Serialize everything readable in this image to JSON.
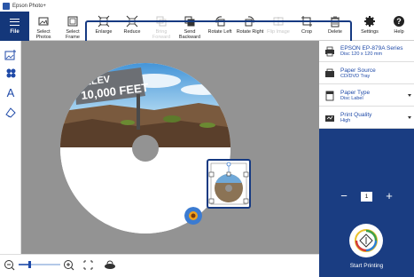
{
  "window": {
    "title": "Epson Photo+"
  },
  "toolbar": {
    "file": "File",
    "items": [
      {
        "label": "Select Photos",
        "icon": "photo-icon",
        "enabled": true
      },
      {
        "label": "Select Frame",
        "icon": "frame-icon",
        "enabled": true
      },
      {
        "label": "Enlarge",
        "icon": "enlarge-icon",
        "enabled": true
      },
      {
        "label": "Reduce",
        "icon": "reduce-icon",
        "enabled": true
      },
      {
        "label": "Bring Forward",
        "icon": "bring-forward-icon",
        "enabled": false
      },
      {
        "label": "Send Backward",
        "icon": "send-backward-icon",
        "enabled": true
      },
      {
        "label": "Rotate Left",
        "icon": "rotate-left-icon",
        "enabled": true
      },
      {
        "label": "Rotate Right",
        "icon": "rotate-right-icon",
        "enabled": true
      },
      {
        "label": "Flip Image",
        "icon": "flip-icon",
        "enabled": false
      },
      {
        "label": "Crop",
        "icon": "crop-icon",
        "enabled": true
      },
      {
        "label": "Delete",
        "icon": "delete-icon",
        "enabled": true
      },
      {
        "label": "Settings",
        "icon": "gear-icon",
        "enabled": true
      },
      {
        "label": "Help",
        "icon": "help-icon",
        "enabled": true
      }
    ]
  },
  "left_tools": [
    "add-photo-icon",
    "stamp-icon",
    "text-icon",
    "background-icon"
  ],
  "canvas": {
    "photo_text_line1": "ELEV",
    "photo_text_line2": "10,000 FEET"
  },
  "right_panel": {
    "printer": {
      "name": "EPSON EP-879A Series",
      "detail": "Disc 120 x 120 mm"
    },
    "paper_source": {
      "label": "Paper Source",
      "value": "CD/DVD Tray"
    },
    "paper_type": {
      "label": "Paper Type",
      "value": "Disc Label"
    },
    "print_quality": {
      "label": "Print Quality",
      "value": "High"
    },
    "copies": "1",
    "minus": "−",
    "plus": "+",
    "start": "Start Printing"
  },
  "colors": {
    "accent": "#163a82",
    "panel": "#1a3d82",
    "link": "#1f4aa8"
  }
}
